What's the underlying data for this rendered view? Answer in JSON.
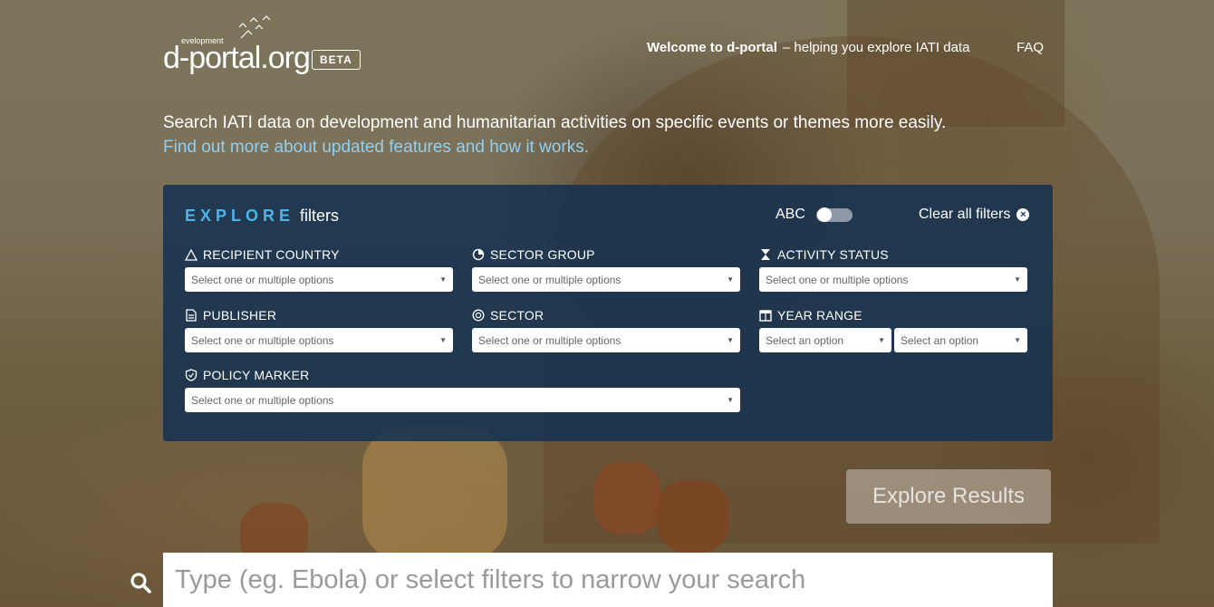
{
  "brand": {
    "small_text": "evelopment",
    "name": "d-portal.org",
    "badge": "BETA"
  },
  "nav": {
    "welcome_bold": "Welcome to d-portal",
    "welcome_rest": "– helping you explore IATI data",
    "faq": "FAQ"
  },
  "intro": {
    "text": "Search IATI data on development and humanitarian activities on specific events or themes more easily.",
    "link": "Find out more about updated features and how it works."
  },
  "filters": {
    "title_accent": "EXPLORE",
    "title_rest": "filters",
    "abc_label": "ABC",
    "abc_toggle_on": false,
    "clear_label": "Clear all filters",
    "recipient_country": {
      "label": "RECIPIENT COUNTRY",
      "placeholder": "Select one or multiple options"
    },
    "sector_group": {
      "label": "SECTOR GROUP",
      "placeholder": "Select one or multiple options"
    },
    "activity_status": {
      "label": "ACTIVITY STATUS",
      "placeholder": "Select one or multiple options"
    },
    "publisher": {
      "label": "PUBLISHER",
      "placeholder": "Select one or multiple options"
    },
    "sector": {
      "label": "SECTOR",
      "placeholder": "Select one or multiple options"
    },
    "year_range": {
      "label": "YEAR RANGE",
      "from_placeholder": "Select an option",
      "to_placeholder": "Select an option"
    },
    "policy_marker": {
      "label": "POLICY MARKER",
      "placeholder": "Select one or multiple options"
    }
  },
  "explore_button": "Explore Results",
  "search": {
    "placeholder": "Type (eg. Ebola) or select filters to narrow your search"
  },
  "colors": {
    "accent": "#4fb3ea",
    "link": "#8fd0f5",
    "panel": "#163250"
  }
}
